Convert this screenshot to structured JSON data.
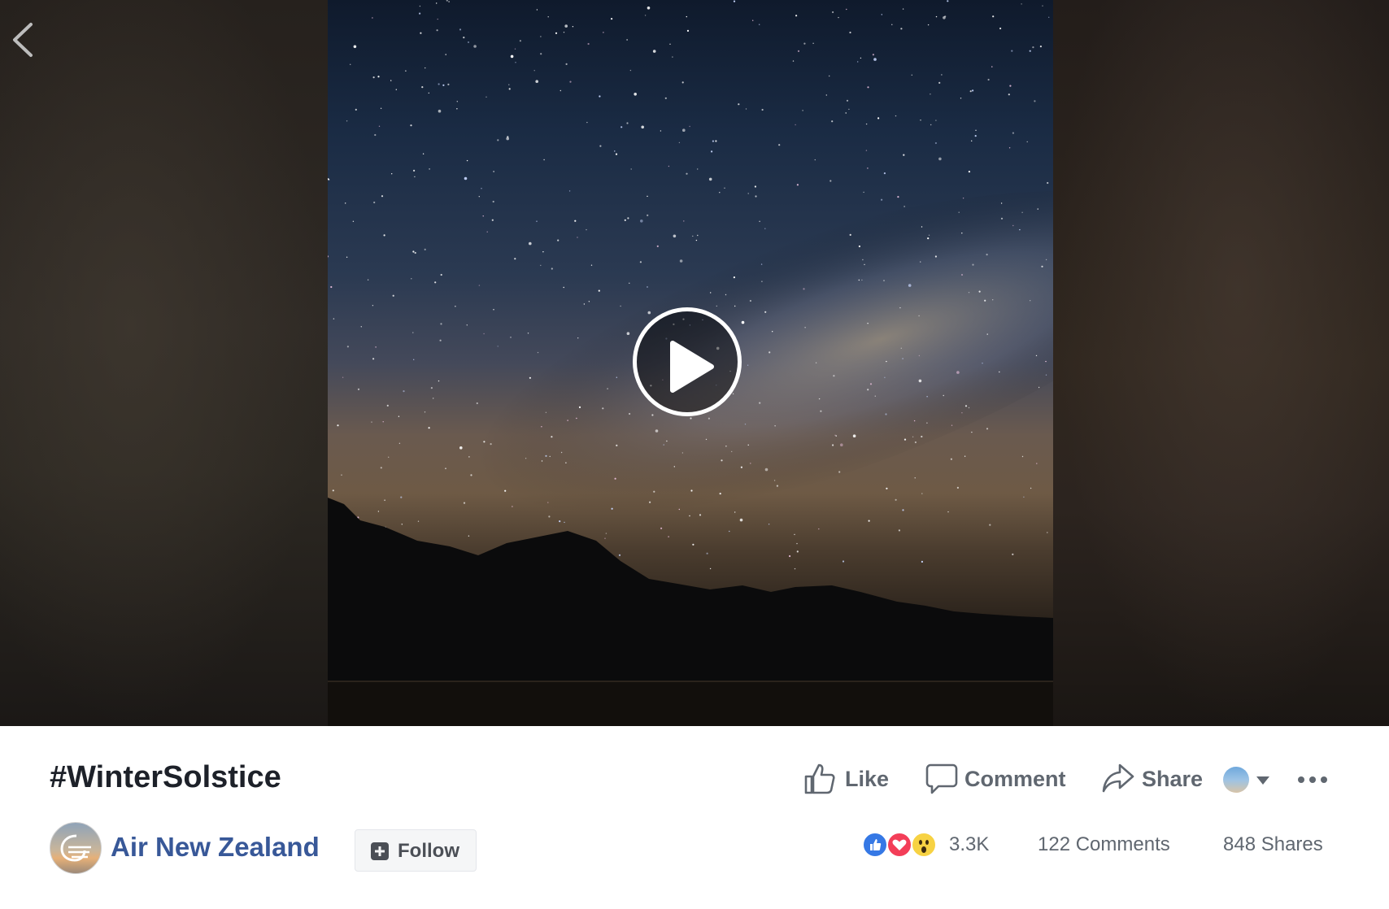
{
  "post": {
    "title": "#WinterSolstice"
  },
  "page": {
    "name": "Air New Zealand",
    "follow_label": "Follow"
  },
  "actions": {
    "like_label": "Like",
    "comment_label": "Comment",
    "share_label": "Share"
  },
  "stats": {
    "reactions_count": "3.3K",
    "comments": "122 Comments",
    "shares": "848 Shares"
  },
  "icons": {
    "back": "chevron-left-icon",
    "play": "play-icon",
    "like": "thumbs-up-icon",
    "comment": "speech-bubble-icon",
    "share": "share-arrow-icon",
    "more": "ellipsis-icon",
    "follow": "follow-plus-icon"
  },
  "colors": {
    "page_link": "#385898",
    "action_text": "#606770",
    "title": "#1d2129",
    "like_reaction": "#3578e5",
    "love_reaction": "#f33e58",
    "wow_reaction": "#f7d243"
  }
}
